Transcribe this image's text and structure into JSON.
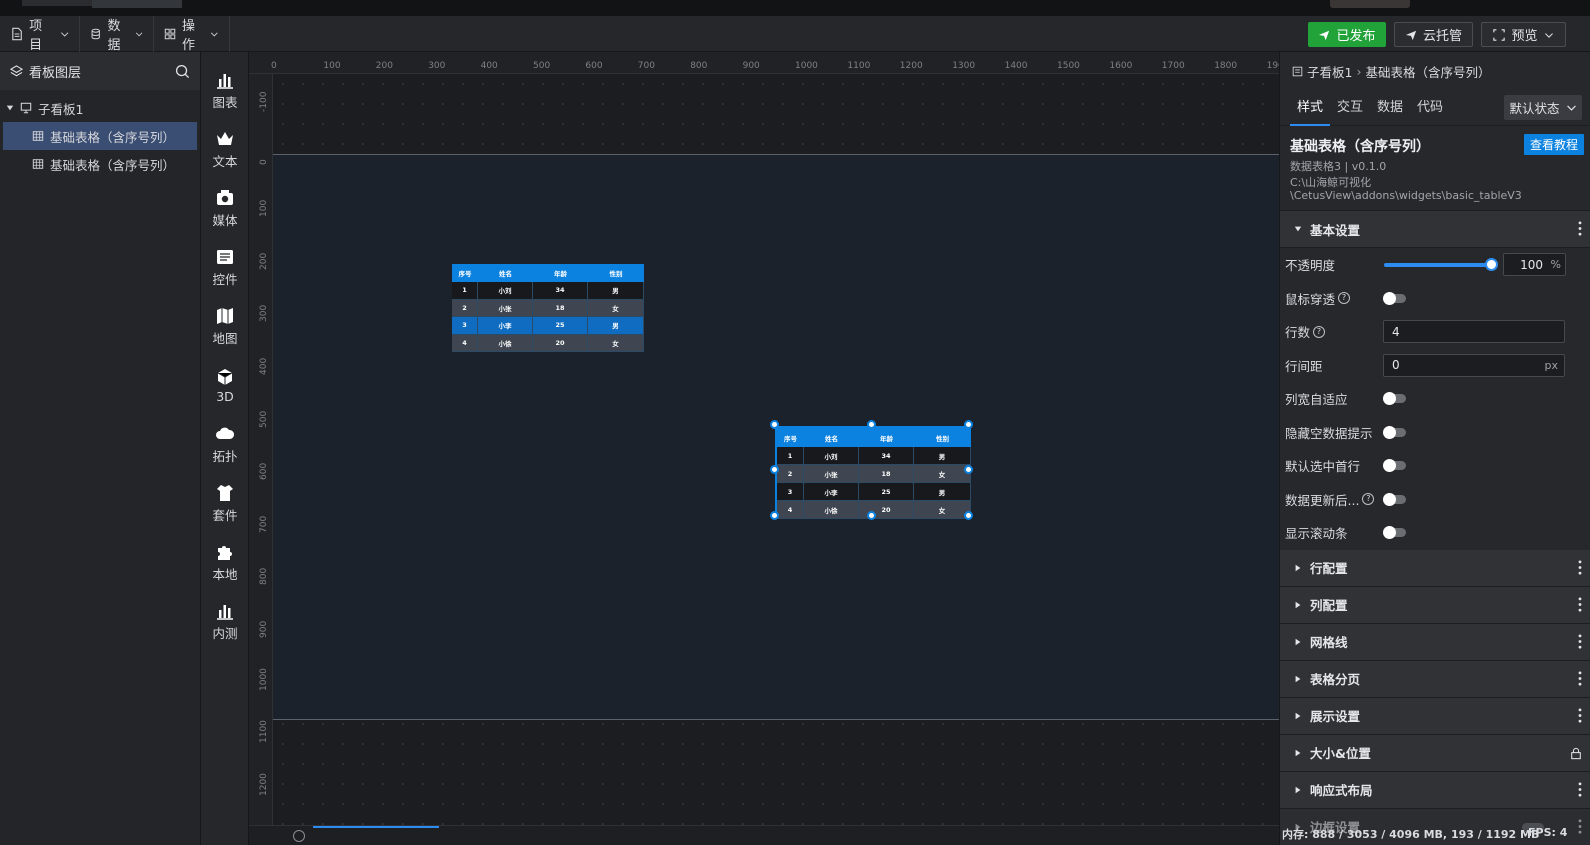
{
  "toolbar": {
    "project": "项目",
    "data": "数据",
    "ops": "操作",
    "published": "已发布",
    "cloud": "云托管",
    "preview": "预览"
  },
  "layers": {
    "title": "看板图层",
    "group": "子看板1",
    "items": [
      "基础表格（含序号列）",
      "基础表格（含序号列）"
    ]
  },
  "palette": {
    "items": [
      "图表",
      "文本",
      "媒体",
      "控件",
      "地图",
      "3D",
      "拓扑",
      "套件",
      "本地",
      "内测"
    ]
  },
  "ruler": {
    "top": [
      "0",
      "100",
      "200",
      "300",
      "400",
      "500",
      "600",
      "700",
      "800",
      "900",
      "1000",
      "1100",
      "1200",
      "1300",
      "1400",
      "1500",
      "1600",
      "1700",
      "1800",
      "1900"
    ],
    "left": [
      "-100",
      "0",
      "100",
      "200",
      "300",
      "400",
      "500",
      "600",
      "700",
      "800",
      "900",
      "1000",
      "1100",
      "1200"
    ]
  },
  "table": {
    "headers": [
      "序号",
      "姓名",
      "年龄",
      "性别"
    ],
    "rows": [
      [
        "1",
        "小刘",
        "34",
        "男"
      ],
      [
        "2",
        "小张",
        "18",
        "女"
      ],
      [
        "3",
        "小李",
        "25",
        "男"
      ],
      [
        "4",
        "小徐",
        "20",
        "女"
      ]
    ]
  },
  "props": {
    "breadcrumb_parent": "子看板1",
    "breadcrumb_current": "基础表格（含序号列）",
    "tabs": [
      "样式",
      "交互",
      "数据",
      "代码"
    ],
    "state": "默认状态",
    "widget_title": "基础表格（含序号列）",
    "widget_version": "数据表格3 | v0.1.0",
    "widget_path_1": "C:\\山海鲸可视化",
    "widget_path_2": "\\CetusView\\addons\\widgets\\basic_tableV3",
    "tutorial": "查看教程",
    "basic_section": "基本设置",
    "opacity_label": "不透明度",
    "opacity_value": "100",
    "opacity_unit": "%",
    "opacity_fraction": 1.0,
    "mouse_through": "鼠标穿透",
    "rows_label": "行数",
    "rows_value": "4",
    "row_gap_label": "行间距",
    "row_gap_value": "0",
    "row_gap_unit": "px",
    "col_auto": "列宽自适应",
    "hide_empty": "隐藏空数据提示",
    "select_first": "默认选中首行",
    "after_update": "数据更新后...",
    "show_scroll": "显示滚动条",
    "sections": [
      "行配置",
      "列配置",
      "网格线",
      "表格分页",
      "展示设置",
      "大小&位置",
      "响应式布局",
      "边框设置"
    ]
  },
  "status": {
    "memory": "内存: 888 / 3053 / 4096 MB, 193 / 1192 MB",
    "fps": "FPS: 4"
  }
}
